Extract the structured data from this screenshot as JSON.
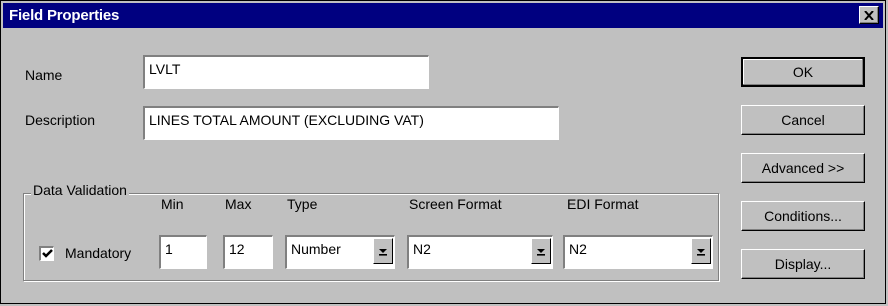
{
  "window": {
    "title": "Field Properties"
  },
  "fields": {
    "name": {
      "label": "Name",
      "value": "LVLT"
    },
    "description": {
      "label": "Description",
      "value": "LINES TOTAL AMOUNT (EXCLUDING VAT)"
    }
  },
  "data_validation": {
    "group_title": "Data Validation",
    "mandatory": {
      "label": "Mandatory",
      "checked": true
    },
    "min": {
      "label": "Min",
      "value": "1"
    },
    "max": {
      "label": "Max",
      "value": "12"
    },
    "type": {
      "label": "Type",
      "value": "Number"
    },
    "screen_format": {
      "label": "Screen Format",
      "value": "N2"
    },
    "edi_format": {
      "label": "EDI Format",
      "value": "N2"
    }
  },
  "buttons": {
    "ok": "OK",
    "cancel": "Cancel",
    "advanced": "Advanced >>",
    "conditions": "Conditions...",
    "display": "Display..."
  },
  "icons": {
    "close": "close-icon",
    "check": "checkmark-icon",
    "dropdown": "dropdown-arrow-icon"
  }
}
